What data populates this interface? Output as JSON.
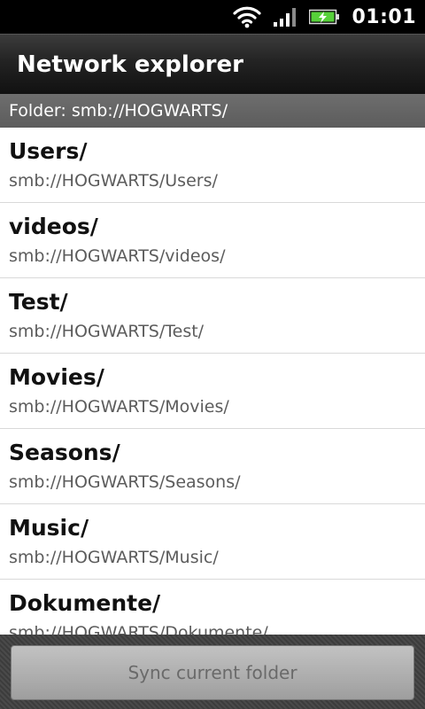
{
  "status_bar": {
    "time": "01:01",
    "icons": [
      "wifi-icon",
      "signal-icon",
      "battery-charging-icon"
    ],
    "battery_color": "#57d13a"
  },
  "title_bar": {
    "title": "Network explorer"
  },
  "folder_header": {
    "label": "Folder: smb://HOGWARTS/"
  },
  "list": {
    "items": [
      {
        "name": "Users/",
        "path": "smb://HOGWARTS/Users/"
      },
      {
        "name": "videos/",
        "path": "smb://HOGWARTS/videos/"
      },
      {
        "name": "Test/",
        "path": "smb://HOGWARTS/Test/"
      },
      {
        "name": "Movies/",
        "path": "smb://HOGWARTS/Movies/"
      },
      {
        "name": "Seasons/",
        "path": "smb://HOGWARTS/Seasons/"
      },
      {
        "name": "Music/",
        "path": "smb://HOGWARTS/Music/"
      },
      {
        "name": "Dokumente/",
        "path": "smb://HOGWARTS/Dokumente/"
      }
    ]
  },
  "bottom_bar": {
    "sync_label": "Sync current folder"
  }
}
